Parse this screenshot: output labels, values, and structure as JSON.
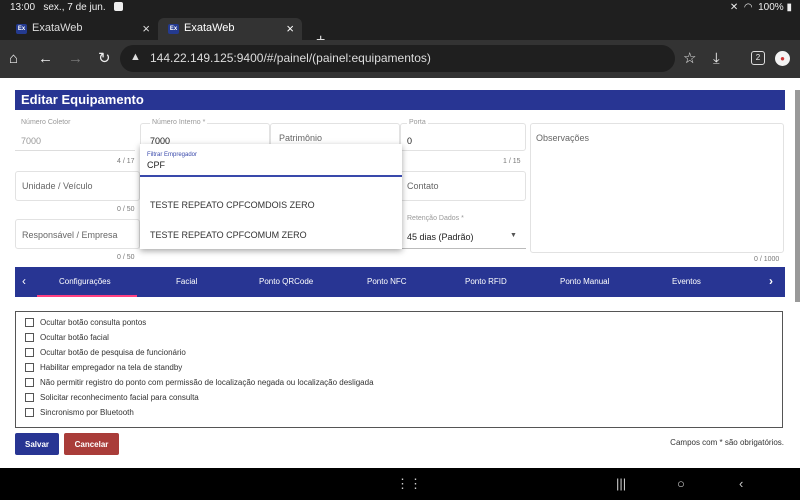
{
  "status_bar": {
    "time": "13:00",
    "date": "sex., 7 de jun.",
    "battery": "100%"
  },
  "browser": {
    "tabs": [
      {
        "title": "ExataWeb",
        "favicon": "Ex",
        "active": false
      },
      {
        "title": "ExataWeb",
        "favicon": "Ex",
        "active": true
      }
    ],
    "url": "144.22.149.125:9400/#/painel/(painel:equipamentos)",
    "tab_count": "2"
  },
  "form": {
    "title": "Editar Equipamento",
    "numero_coletor": {
      "label": "Número Coletor",
      "value": "7000",
      "counter": "4 / 17"
    },
    "numero_interno": {
      "label": "Número Interno *",
      "value": "7000"
    },
    "patrimonio": {
      "placeholder": "Patrimônio"
    },
    "porta": {
      "label": "Porta",
      "value": "0",
      "counter": "1 / 15"
    },
    "observacoes": {
      "placeholder": "Observações",
      "counter": "0 / 1000"
    },
    "unidade": {
      "placeholder": "Unidade / Veículo",
      "counter": "0 / 50"
    },
    "contato": {
      "placeholder": "Contato"
    },
    "responsavel": {
      "placeholder": "Responsável / Empresa",
      "counter": "0 / 50"
    },
    "retencao": {
      "label": "Retenção Dados *",
      "value": "45 dias (Padrão)"
    }
  },
  "dropdown": {
    "filter_label": "Filtrar Empregador",
    "filter_value": "CPF",
    "options": [
      "TESTE REPEATO CPFCOMDOIS ZERO",
      "TESTE REPEATO CPFCOMUM ZERO"
    ]
  },
  "tabs": [
    "Configurações",
    "Facial",
    "Ponto QRCode",
    "Ponto NFC",
    "Ponto RFID",
    "Ponto Manual",
    "Eventos"
  ],
  "options": [
    "Ocultar botão consulta pontos",
    "Ocultar botão facial",
    "Ocultar botão de pesquisa de funcionário",
    "Habilitar empregador na tela de standby",
    "Não permitir registro do ponto com permissão de localização negada ou localização desligada",
    "Solicitar reconhecimento facial para consulta",
    "Sincronismo por Bluetooth"
  ],
  "buttons": {
    "save": "Salvar",
    "cancel": "Cancelar"
  },
  "required_note": "Campos com * são obrigatórios.",
  "colors": {
    "primary": "#283593",
    "cancel": "#a93c39",
    "ink": "#ff4081"
  }
}
